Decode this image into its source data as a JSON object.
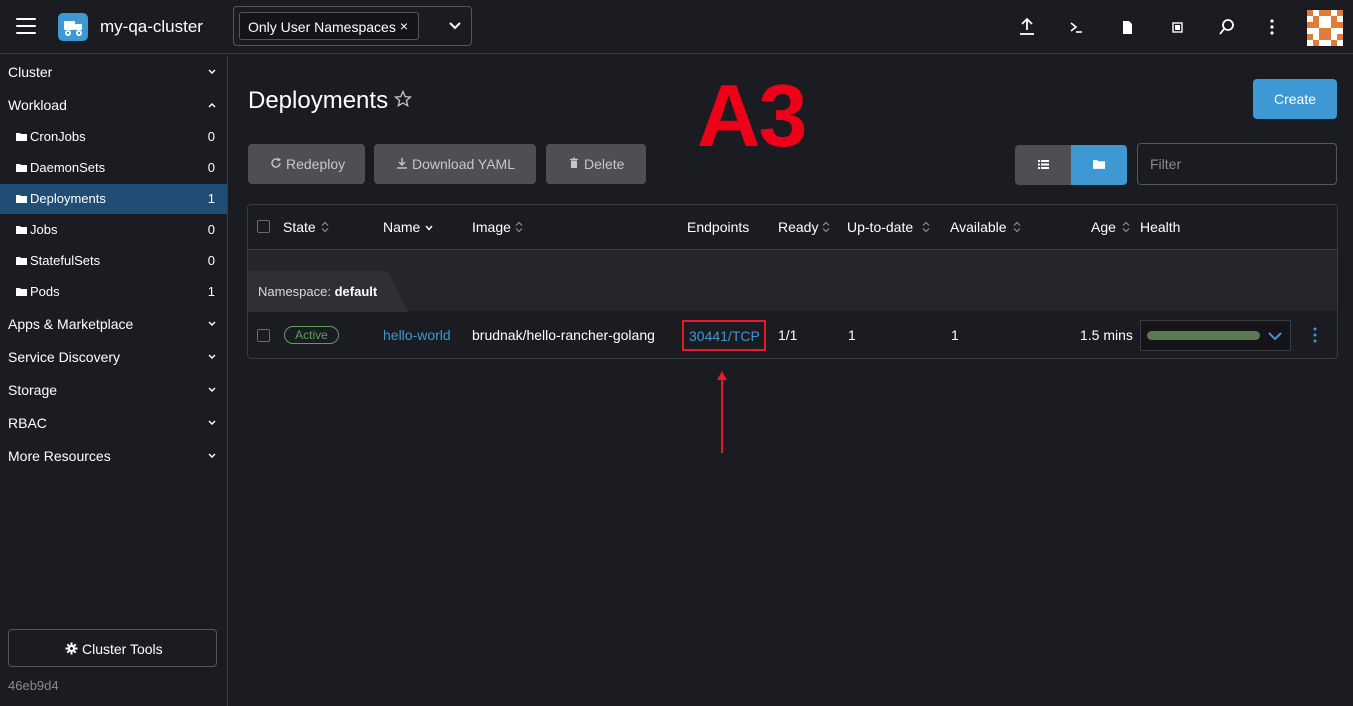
{
  "header": {
    "cluster_name": "my-qa-cluster",
    "namespace_filter": "Only User Namespaces",
    "namespace_remove": "×"
  },
  "sidebar": {
    "groups_top": [
      {
        "label": "Cluster",
        "expanded": false
      },
      {
        "label": "Workload",
        "expanded": true
      }
    ],
    "workload_items": [
      {
        "label": "CronJobs",
        "count": "0",
        "active": false
      },
      {
        "label": "DaemonSets",
        "count": "0",
        "active": false
      },
      {
        "label": "Deployments",
        "count": "1",
        "active": true
      },
      {
        "label": "Jobs",
        "count": "0",
        "active": false
      },
      {
        "label": "StatefulSets",
        "count": "0",
        "active": false
      },
      {
        "label": "Pods",
        "count": "1",
        "active": false
      }
    ],
    "groups_bottom": [
      {
        "label": "Apps & Marketplace"
      },
      {
        "label": "Service Discovery"
      },
      {
        "label": "Storage"
      },
      {
        "label": "RBAC"
      },
      {
        "label": "More Resources"
      }
    ],
    "cluster_tools_label": "Cluster Tools",
    "version": "46eb9d4"
  },
  "main": {
    "title": "Deployments",
    "create_label": "Create",
    "overlay_text": "A3",
    "actions": {
      "redeploy": "Redeploy",
      "download_yaml": "Download YAML",
      "delete": "Delete"
    },
    "filter_placeholder": "Filter"
  },
  "table": {
    "columns": {
      "state": "State",
      "name": "Name",
      "image": "Image",
      "endpoints": "Endpoints",
      "ready": "Ready",
      "up_to_date": "Up-to-date",
      "available": "Available",
      "age": "Age",
      "health": "Health"
    },
    "group": {
      "prefix": "Namespace:",
      "name": "default"
    },
    "rows": [
      {
        "state": "Active",
        "name": "hello-world",
        "image": "brudnak/hello-rancher-golang",
        "endpoint": "30441/TCP",
        "ready": "1/1",
        "up_to_date": "1",
        "available": "1",
        "age": "1.5 mins"
      }
    ]
  },
  "colors": {
    "accent": "#3d98d3",
    "active_state": "#5aa05a",
    "annotation_red": "#ee0019",
    "health_bar": "#5a7a56"
  }
}
